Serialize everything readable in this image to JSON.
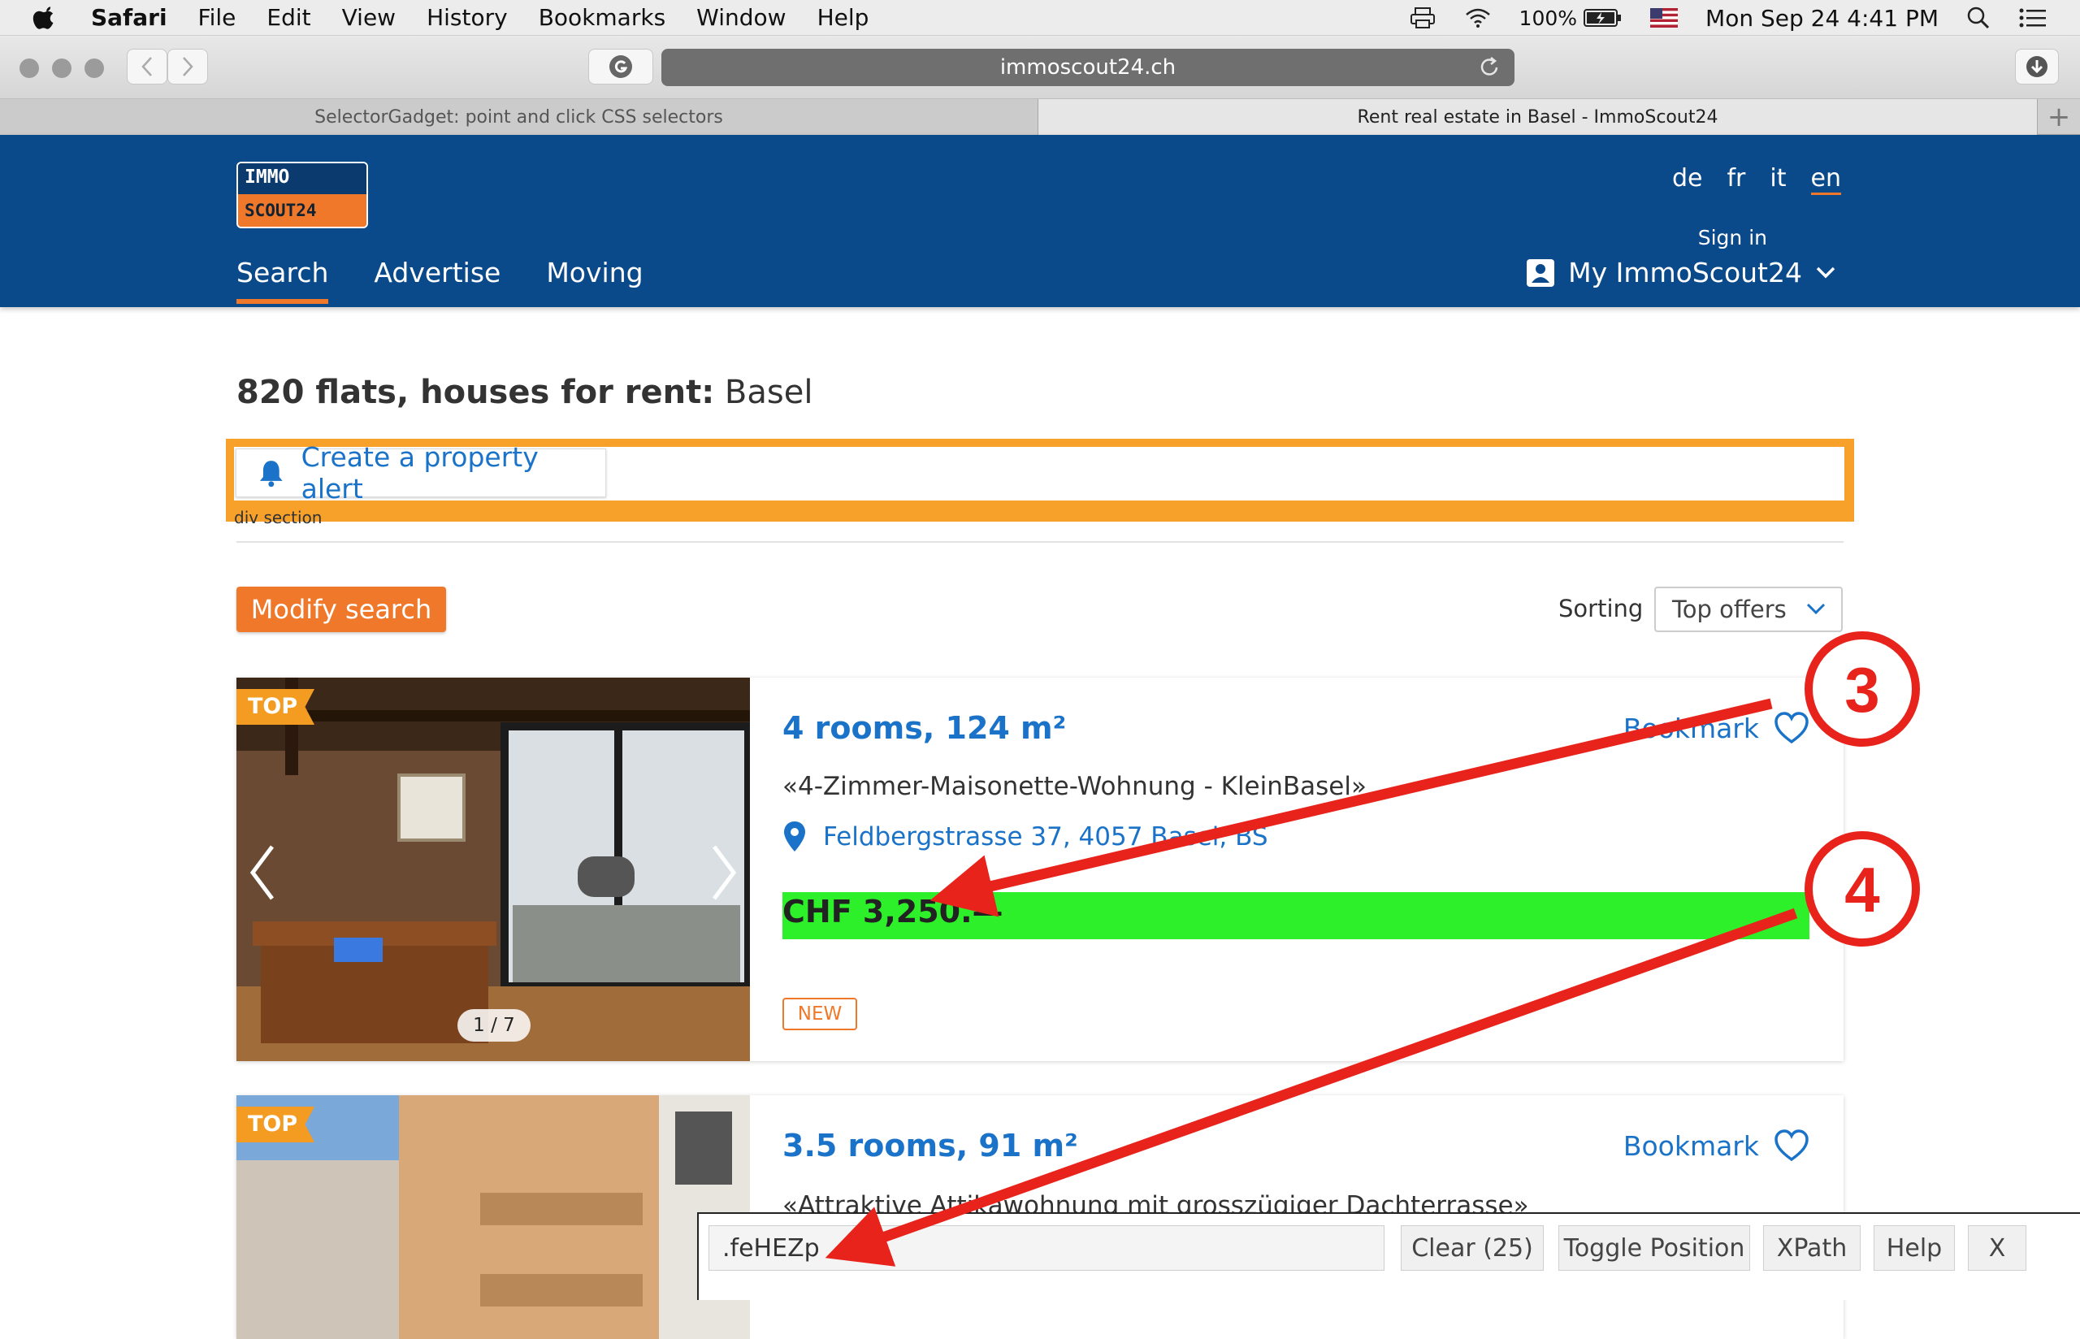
{
  "menubar": {
    "app_name": "Safari",
    "menu_items": [
      "File",
      "Edit",
      "View",
      "History",
      "Bookmarks",
      "Window",
      "Help"
    ],
    "battery": "100%",
    "datetime": "Mon Sep 24  4:41 PM"
  },
  "browser": {
    "url": "immoscout24.ch",
    "tabs": [
      {
        "label": "SelectorGadget: point and click CSS selectors",
        "active": false
      },
      {
        "label": "Rent real estate in Basel - ImmoScout24",
        "active": true
      }
    ]
  },
  "site": {
    "logo_top": "IMMO",
    "logo_bottom": "SCOUT24",
    "nav": [
      "Search",
      "Advertise",
      "Moving"
    ],
    "languages": [
      "de",
      "fr",
      "it",
      "en"
    ],
    "active_language": "en",
    "sign_in": "Sign in",
    "account": "My ImmoScout24"
  },
  "results": {
    "count_bold": "820 flats, houses for rent:",
    "location": "Basel",
    "alert_button": "Create a property alert",
    "highlight_label": "div section",
    "modify_search": "Modify search",
    "sorting_label": "Sorting",
    "sorting_value": "Top offers"
  },
  "listings": [
    {
      "badge": "TOP",
      "title": "4 rooms, 124 m²",
      "subtitle": "«4-Zimmer-Maisonette-Wohnung - KleinBasel»",
      "address": "Feldbergstrasse 37, 4057 Basel, BS",
      "price": "CHF 3,250.—",
      "bookmark": "Bookmark",
      "tag": "NEW",
      "image_counter": "1 / 7"
    },
    {
      "badge": "TOP",
      "title": "3.5 rooms, 91 m²",
      "subtitle": "«Attraktive Attikawohnung mit grosszügiger Dachterrasse»",
      "bookmark": "Bookmark"
    }
  ],
  "selector_gadget": {
    "selector": ".feHEZp",
    "clear": "Clear (25)",
    "toggle": "Toggle Position",
    "xpath": "XPath",
    "help": "Help",
    "close": "X"
  },
  "annotations": {
    "marker_3": "3",
    "marker_4": "4"
  },
  "colors": {
    "brand_blue": "#0b4a8a",
    "brand_orange": "#f0782a",
    "link_blue": "#1a73c8",
    "highlight_orange": "#f7a02a",
    "highlight_green": "#2df02a",
    "annotation_red": "#e8231c"
  }
}
